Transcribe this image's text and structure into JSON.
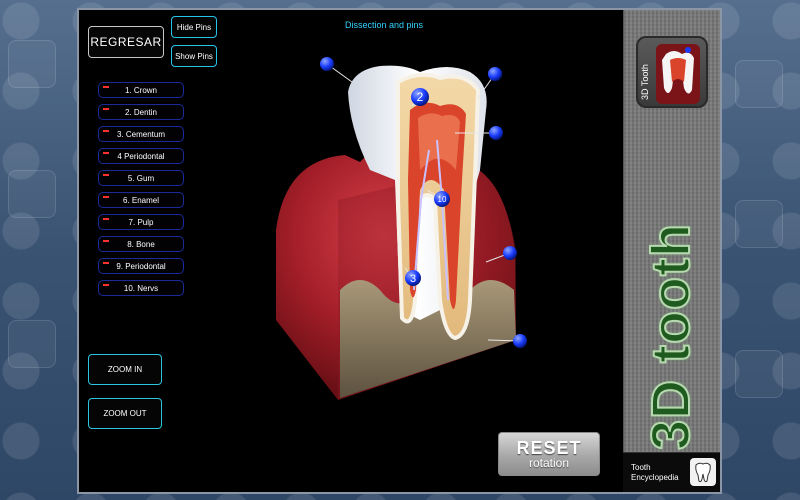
{
  "header": {
    "title": "Dissection and pins"
  },
  "buttons": {
    "back": "REGRESAR",
    "hide_pins": "Hide Pins",
    "show_pins": "Show Pins",
    "zoom_in": "ZOOM IN",
    "zoom_out": "ZOOM OUT",
    "reset_main": "RESET",
    "reset_sub": "rotation"
  },
  "parts": [
    "1. Crown",
    "2. Dentin",
    "3. Cementum",
    "4 Periodontal",
    "5. Gum",
    "6. Enamel",
    "7. Pulp",
    "8. Bone",
    "9. Periodontal",
    "10. Nervs"
  ],
  "pins": {
    "pin_2": "2",
    "pin_3": "3",
    "pin_10": "10"
  },
  "side": {
    "brand": "3D tooth",
    "app_icon_label": "3D Tooth",
    "encyclopedia_line1": "Tooth",
    "encyclopedia_line2": "Encyclopedia"
  },
  "colors": {
    "accent_cyan": "#33d3ff",
    "pin_blue": "#1a3cff",
    "gum_red": "#b3262c",
    "brand_green": "#1f5a1f"
  }
}
